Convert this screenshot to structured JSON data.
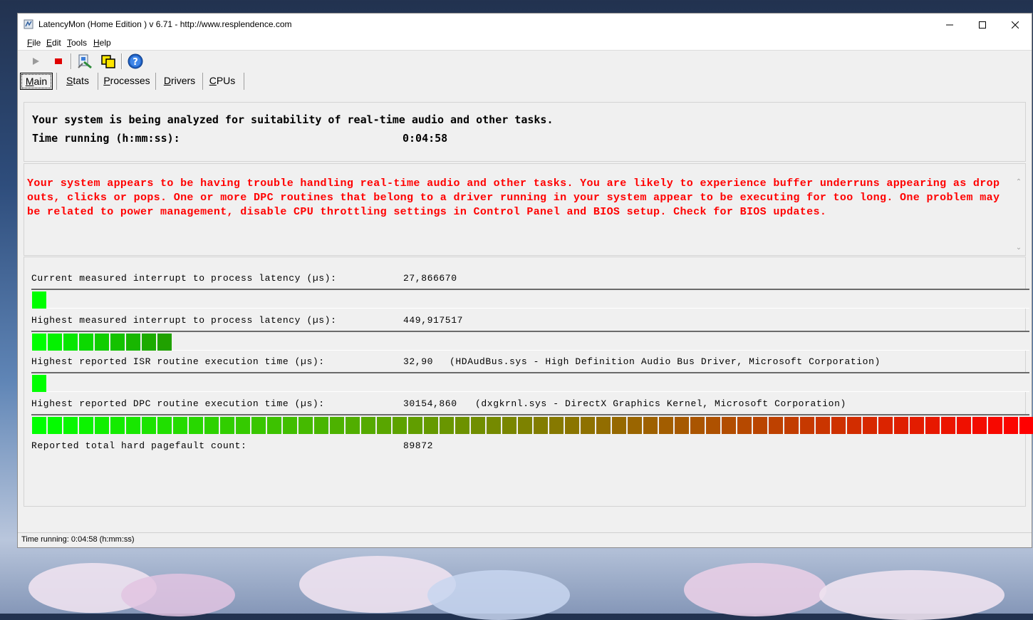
{
  "window": {
    "title": "LatencyMon  (Home Edition )  v 6.71 - http://www.resplendence.com"
  },
  "menu": {
    "file": {
      "u": "F",
      "rest": "ile"
    },
    "edit": {
      "u": "E",
      "rest": "dit"
    },
    "tools": {
      "u": "T",
      "rest": "ools"
    },
    "help": {
      "u": "H",
      "rest": "elp"
    }
  },
  "toolbar": {
    "icons": [
      "play-icon",
      "stop-icon",
      "report-icon",
      "copy-icon",
      "help-icon"
    ]
  },
  "tabs": [
    "Main",
    "Stats",
    "Processes",
    "Drivers",
    "CPUs"
  ],
  "analysis": {
    "line1": "Your system is being analyzed for suitability of real-time audio and other tasks.",
    "time_label": "Time running (h:mm:ss):",
    "time_value": "0:04:58"
  },
  "conclusion": {
    "text": "Your system appears to be having trouble handling real-time audio and other tasks. You are likely to experience buffer underruns appearing as drop outs, clicks or pops. One or more DPC routines that belong to a driver running in your system appear to be executing for too long. One problem may be related to power management, disable CPU throttling settings in Control Panel and BIOS setup. Check for BIOS updates."
  },
  "metrics": [
    {
      "label": "Current measured interrupt to process latency (µs):",
      "value": "27,866670",
      "detail": "",
      "bar_segments": 1
    },
    {
      "label": "Highest measured interrupt to process latency (µs):",
      "value": "449,917517",
      "detail": "",
      "bar_segments": 9
    },
    {
      "label": "Highest reported ISR routine execution time (µs):",
      "value": "32,90",
      "detail": "(HDAudBus.sys - High Definition Audio Bus Driver, Microsoft Corporation)",
      "bar_segments": 1
    },
    {
      "label": "Highest reported DPC routine execution time (µs):",
      "value": "30154,860",
      "detail": "(dxgkrnl.sys - DirectX Graphics Kernel, Microsoft Corporation)",
      "bar_segments": 64
    }
  ],
  "pagefault": {
    "label": "Reported total hard pagefault count:",
    "value": "89872"
  },
  "colors": {
    "bar_start": "#00ff00",
    "bar_end": "#ff0000",
    "warning_text": "#ff0000"
  },
  "status": {
    "text": "Time running: 0:04:58  (h:mm:ss)"
  }
}
